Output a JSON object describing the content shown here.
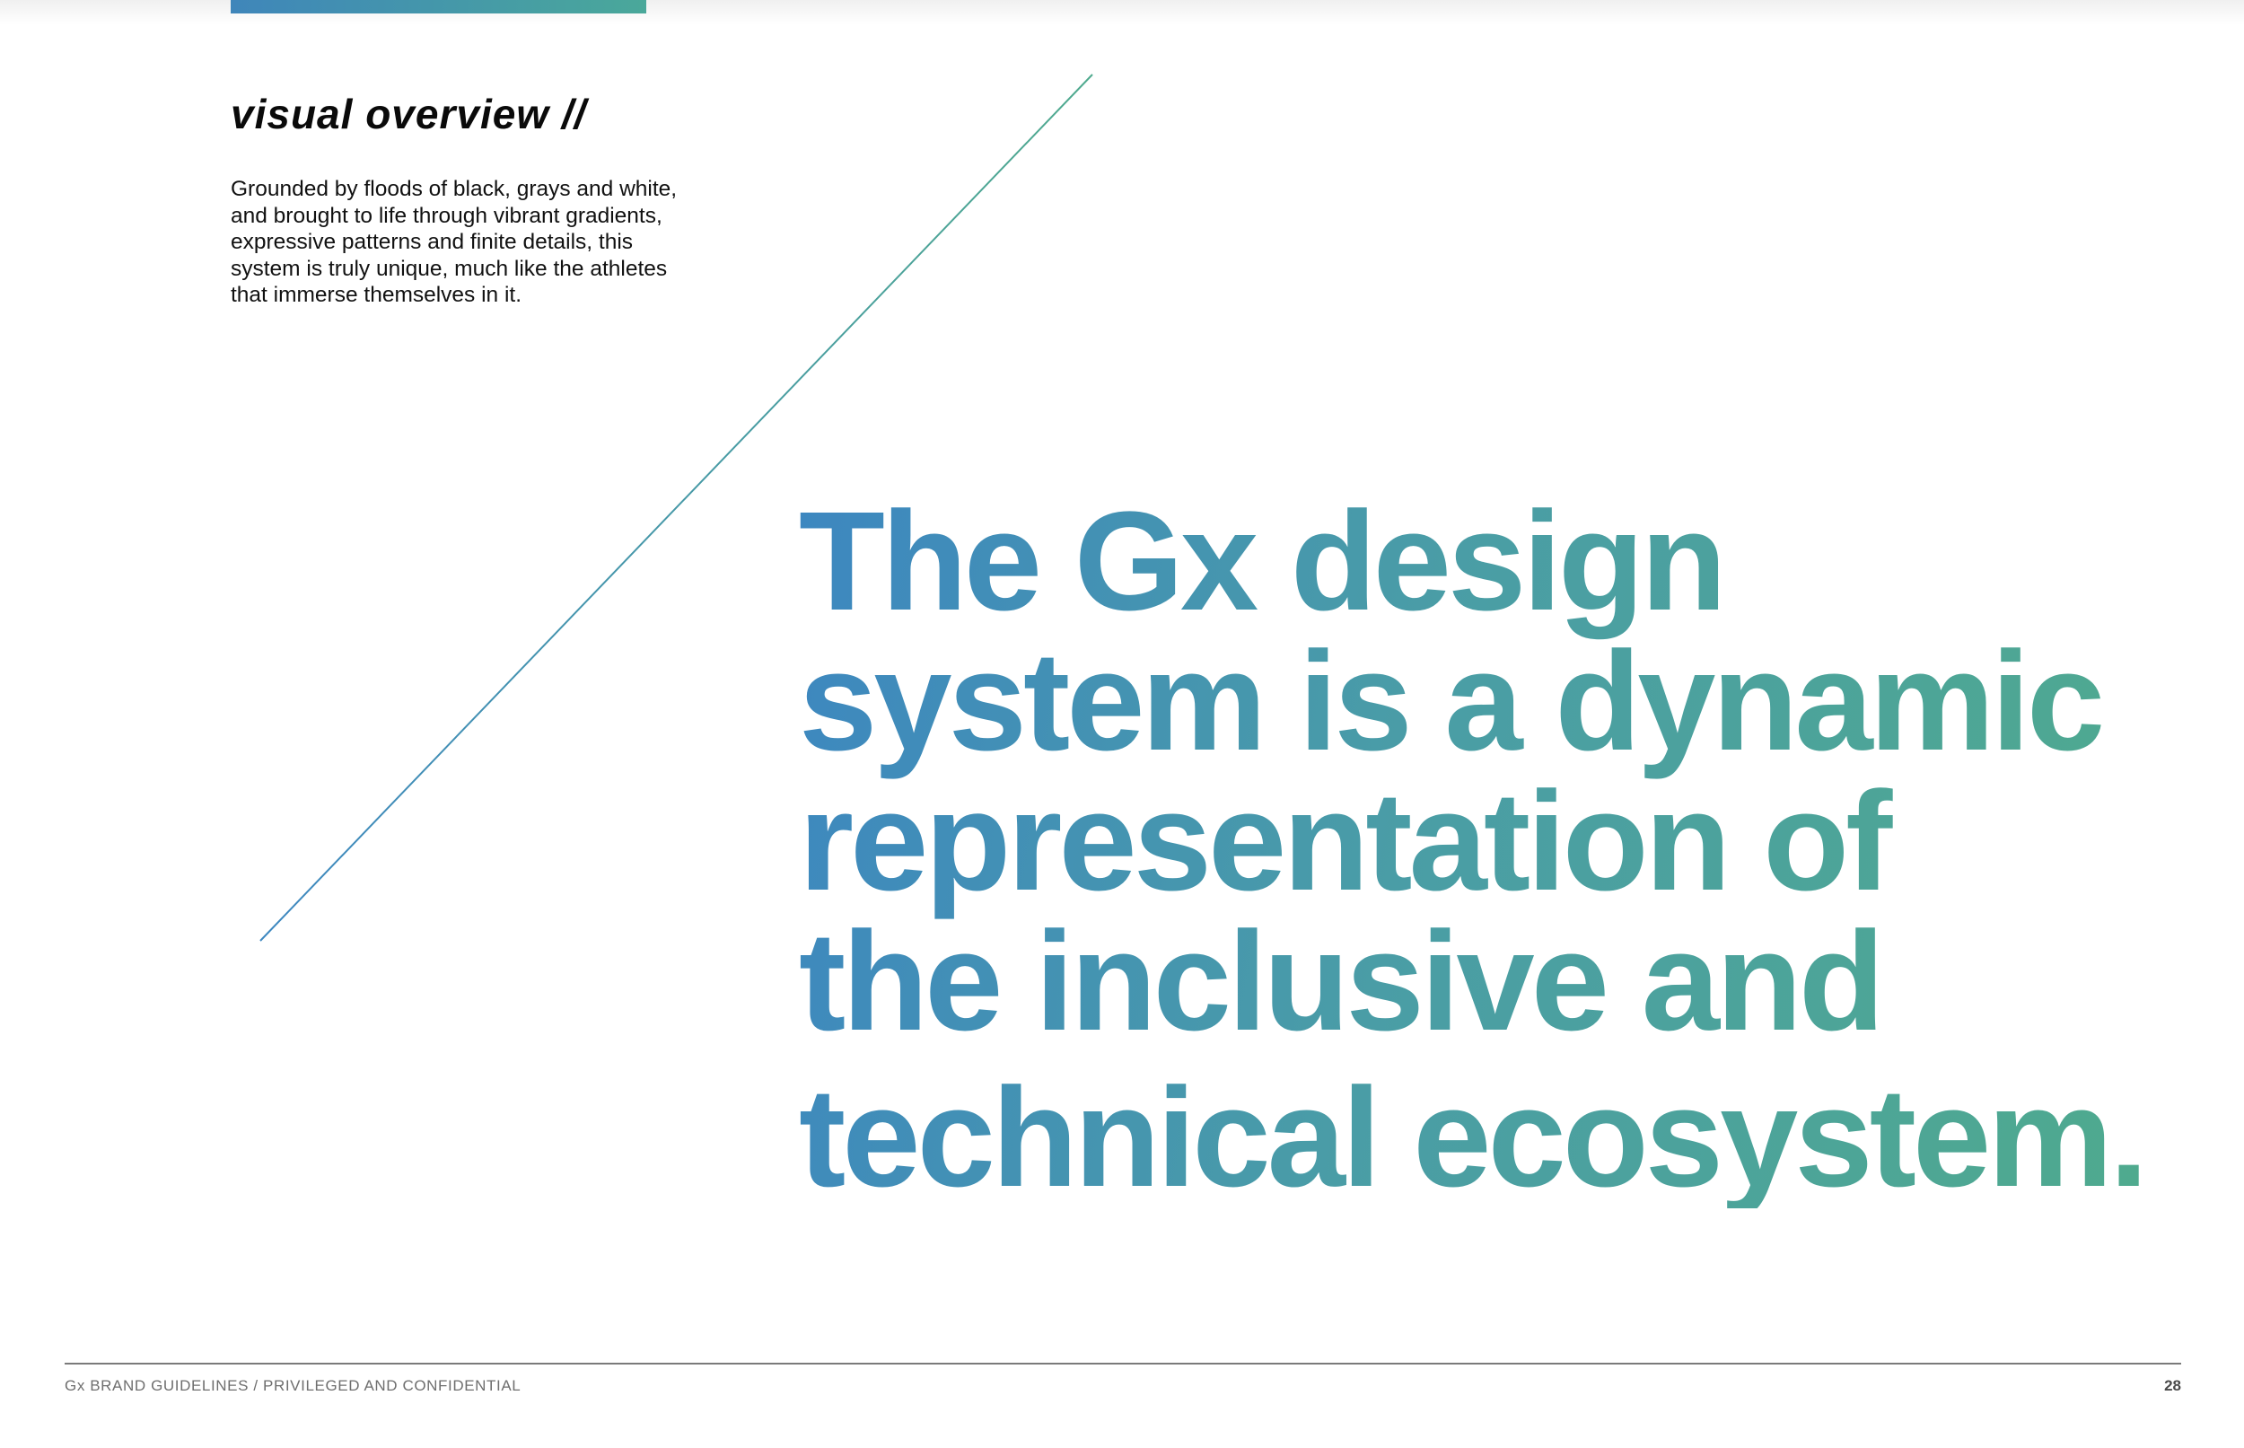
{
  "header": {
    "section_title": "visual overview //"
  },
  "intro": {
    "text": "Grounded by floods of black, grays and white, and brought to life through vibrant gradients, expressive patterns and finite details, this system is truly unique, much like the athletes that immerse themselves in it."
  },
  "headline": {
    "lines": [
      "The Gx design",
      "system is a dynamic",
      "representation of",
      "the inclusive and",
      "technical ecosystem."
    ]
  },
  "footer": {
    "brand": "Gx BRAND GUIDELINES",
    "separator": "/",
    "confidentiality": "PRIVILEGED AND CONFIDENTIAL",
    "page_number": "28"
  },
  "colors": {
    "gradient_start": "#3d87c0",
    "gradient_end": "#4faa8e",
    "text_dark": "#0a0a0a",
    "footer_gray": "#6e6e6e"
  }
}
